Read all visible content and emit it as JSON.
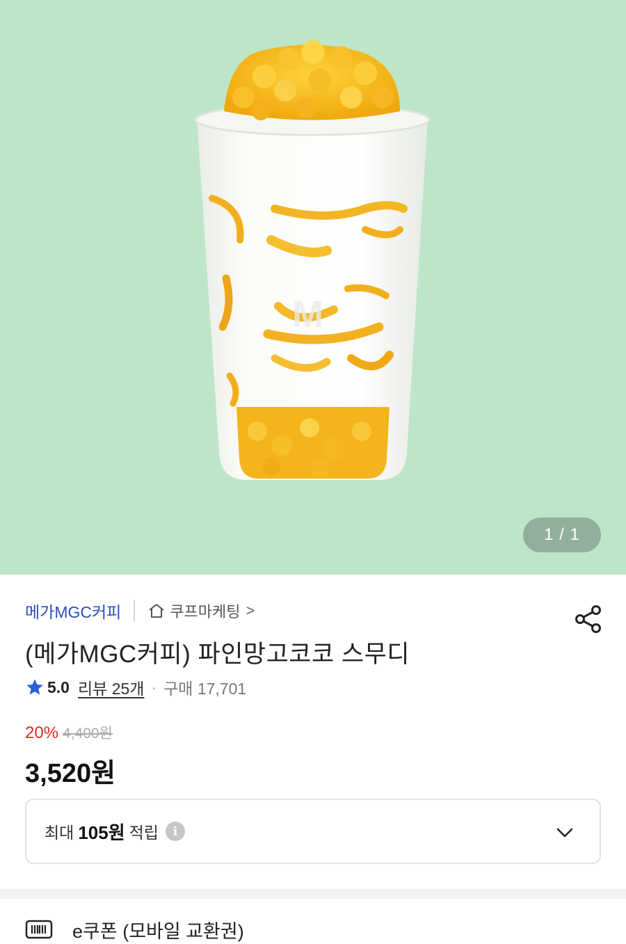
{
  "gallery": {
    "counter": "1 / 1"
  },
  "product": {
    "brand": "메가MGC커피",
    "store": "쿠프마케팅",
    "store_chevron": ">",
    "title": "(메가MGC커피) 파인망고코코 스무디",
    "rating": "5.0",
    "reviews": "리뷰 25개",
    "separator": "·",
    "purchases": "구매 17,701",
    "discount": "20%",
    "original_price": "4,400원",
    "price": "3,520원"
  },
  "points": {
    "prefix": "최대",
    "amount": "105원",
    "suffix": "적립",
    "info_glyph": "i"
  },
  "delivery": {
    "type": "e쿠폰 (모바일 교환권)"
  },
  "colors": {
    "hero_bg": "#bde6c8",
    "brand": "#2b4cbd",
    "discount": "#e0281f",
    "star": "#2b5fd9"
  },
  "icons": [
    "home-icon",
    "share-icon",
    "star-icon",
    "info-icon",
    "chevron-down-icon",
    "barcode-icon"
  ]
}
